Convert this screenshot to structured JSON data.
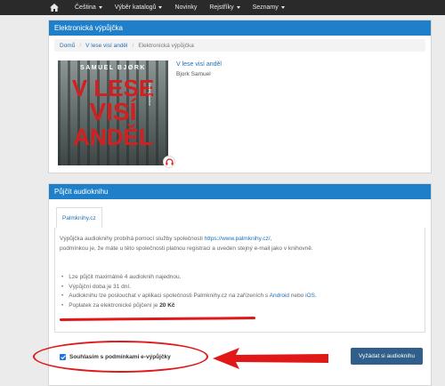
{
  "nav": {
    "items": [
      {
        "label": "Čeština",
        "dropdown": true
      },
      {
        "label": "Výběr katalogů",
        "dropdown": true
      },
      {
        "label": "Novinky",
        "dropdown": false
      },
      {
        "label": "Rejstříky",
        "dropdown": true
      },
      {
        "label": "Seznamy",
        "dropdown": true
      }
    ]
  },
  "panel1": {
    "title": "Elektronická výpůjčka",
    "breadcrumb": {
      "home": "Domů",
      "book": "V lese visí anděl",
      "current": "Elektronická výpůjčka"
    },
    "cover": {
      "author": "SAMUEL BJØRK",
      "line1": "V LESE",
      "line2": "VISÍ",
      "line3": "ANDĚL",
      "side": "Ondřej Sochor"
    },
    "book_title": "V lese visí anděl",
    "book_author": "Bjork Samuel"
  },
  "panel2": {
    "title": "Půjčit audioknihu",
    "tab": "Palmknihy.cz",
    "intro_line1_prefix": "Výpůjčka audioknihy probíhá pomocí služby společnosti ",
    "intro_link": "https://www.palmknihy.cz/",
    "intro_line1_suffix": ",",
    "intro_line2": "podmínkou je, že máte u této společnosti platnou registraci a uveden stejný e-mail jako v knihovně.",
    "bullets": {
      "b1": "Lze půjčit maximálně 4 audioknih najednou.",
      "b2": "Výpůjční doba je 31 dní.",
      "b3_prefix": "Audioknihu lze poslouchat v aplikaci společnosti Palmknihy.cz na zařízeních s ",
      "b3_android": "Android",
      "b3_mid": " nebo ",
      "b3_ios": "iOS",
      "b3_suffix": ".",
      "b4_prefix": "Poplatek za elektronické půjčení je ",
      "b4_price": "20 Kč"
    },
    "consent_label": "Souhlasím s podmínkami e-výpůjčky",
    "consent_checked": true,
    "button": "Vyžádat si audioknihu"
  },
  "colors": {
    "accent": "#1f80c9",
    "annotation": "#e01818",
    "button": "#2f5f8a"
  }
}
